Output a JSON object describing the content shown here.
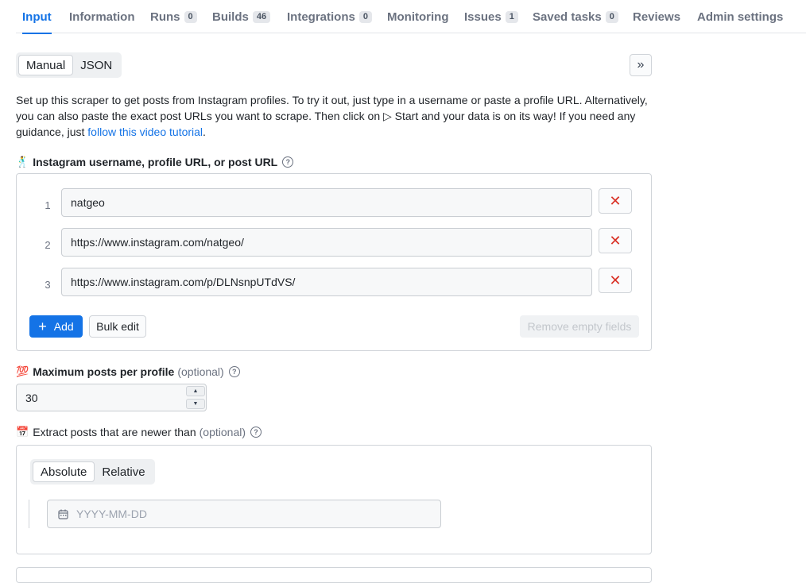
{
  "tabs": [
    {
      "label": "Input",
      "count": null,
      "active": true
    },
    {
      "label": "Information",
      "count": null
    },
    {
      "label": "Runs",
      "count": "0"
    },
    {
      "label": "Builds",
      "count": "46"
    },
    {
      "label": "Integrations",
      "count": "0"
    },
    {
      "label": "Monitoring",
      "count": null
    },
    {
      "label": "Issues",
      "count": "1"
    },
    {
      "label": "Saved tasks",
      "count": "0"
    },
    {
      "label": "Reviews",
      "count": null
    },
    {
      "label": "Admin settings",
      "count": null
    }
  ],
  "mode": {
    "manual": "Manual",
    "json": "JSON",
    "selected": "Manual"
  },
  "collapse_glyph": "»",
  "description": {
    "text": "Set up this scraper to get posts from Instagram profiles. To try it out, just type in a username or paste a profile URL. Alternatively, you can also paste the exact post URLs you want to scrape. Then click on ▷ Start and your data is on its way! If you need any guidance, just ",
    "link": "follow this video tutorial",
    "end": "."
  },
  "usernames": {
    "emoji": "🕺",
    "label": "Instagram username, profile URL, or post URL",
    "rows": [
      {
        "num": "1",
        "value": "natgeo"
      },
      {
        "num": "2",
        "value": "https://www.instagram.com/natgeo/"
      },
      {
        "num": "3",
        "value": "https://www.instagram.com/p/DLNsnpUTdVS/"
      }
    ],
    "add": "Add",
    "bulk_edit": "Bulk edit",
    "remove_empty": "Remove empty fields"
  },
  "max_posts": {
    "emoji": "💯",
    "label": "Maximum posts per profile",
    "optional": "(optional)",
    "value": "30"
  },
  "newer_than": {
    "emoji": "📅",
    "label": "Extract posts that are newer than",
    "optional": "(optional)",
    "absolute": "Absolute",
    "relative": "Relative",
    "selected": "Absolute",
    "placeholder": "YYYY-MM-DD"
  },
  "icons": {
    "help": "?",
    "remove": "✕",
    "plus": "+",
    "up": "▲",
    "down": "▼"
  },
  "colors": {
    "accent": "#1473e6",
    "danger": "#d93025"
  }
}
